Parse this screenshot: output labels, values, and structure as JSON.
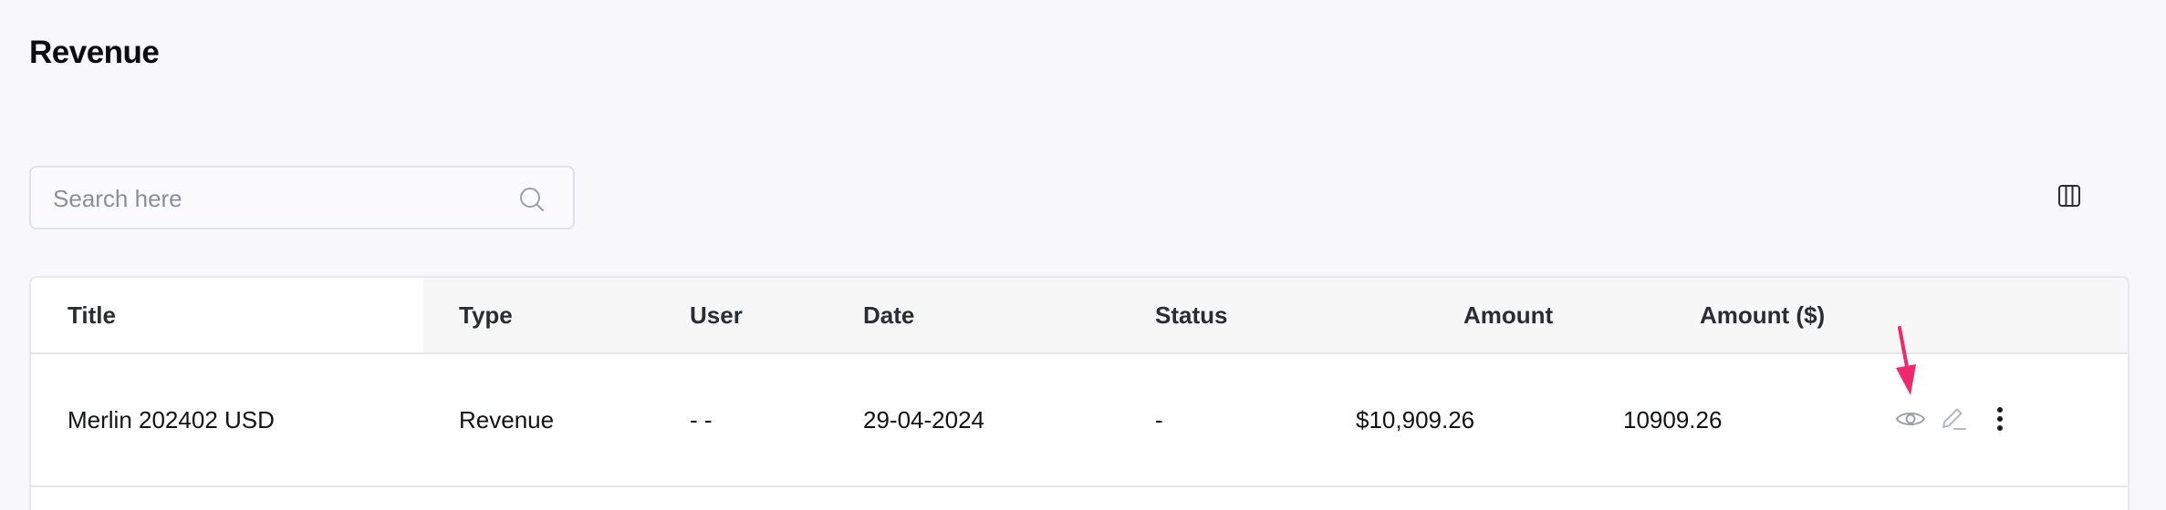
{
  "page": {
    "title": "Revenue"
  },
  "search": {
    "placeholder": "Search here",
    "value": "",
    "icon": "search-icon"
  },
  "toolbar": {
    "columns_icon": "columns-icon"
  },
  "table": {
    "columns": [
      "Title",
      "Type",
      "User",
      "Date",
      "Status",
      "Amount",
      "Amount ($)"
    ],
    "rows": [
      {
        "title": "Merlin 202402 USD",
        "type": "Revenue",
        "user": "- -",
        "date": "29-04-2024",
        "status": "-",
        "amount": "$10,909.26",
        "amount_usd": "10909.26",
        "actions": [
          "eye-icon",
          "pencil-icon",
          "more-vertical-icon"
        ]
      }
    ]
  },
  "colors": {
    "accent_arrow": "#f0296f",
    "border": "#dfe2e7",
    "header_bg": "#f7f7f8",
    "page_bg": "#f8f8fa"
  }
}
